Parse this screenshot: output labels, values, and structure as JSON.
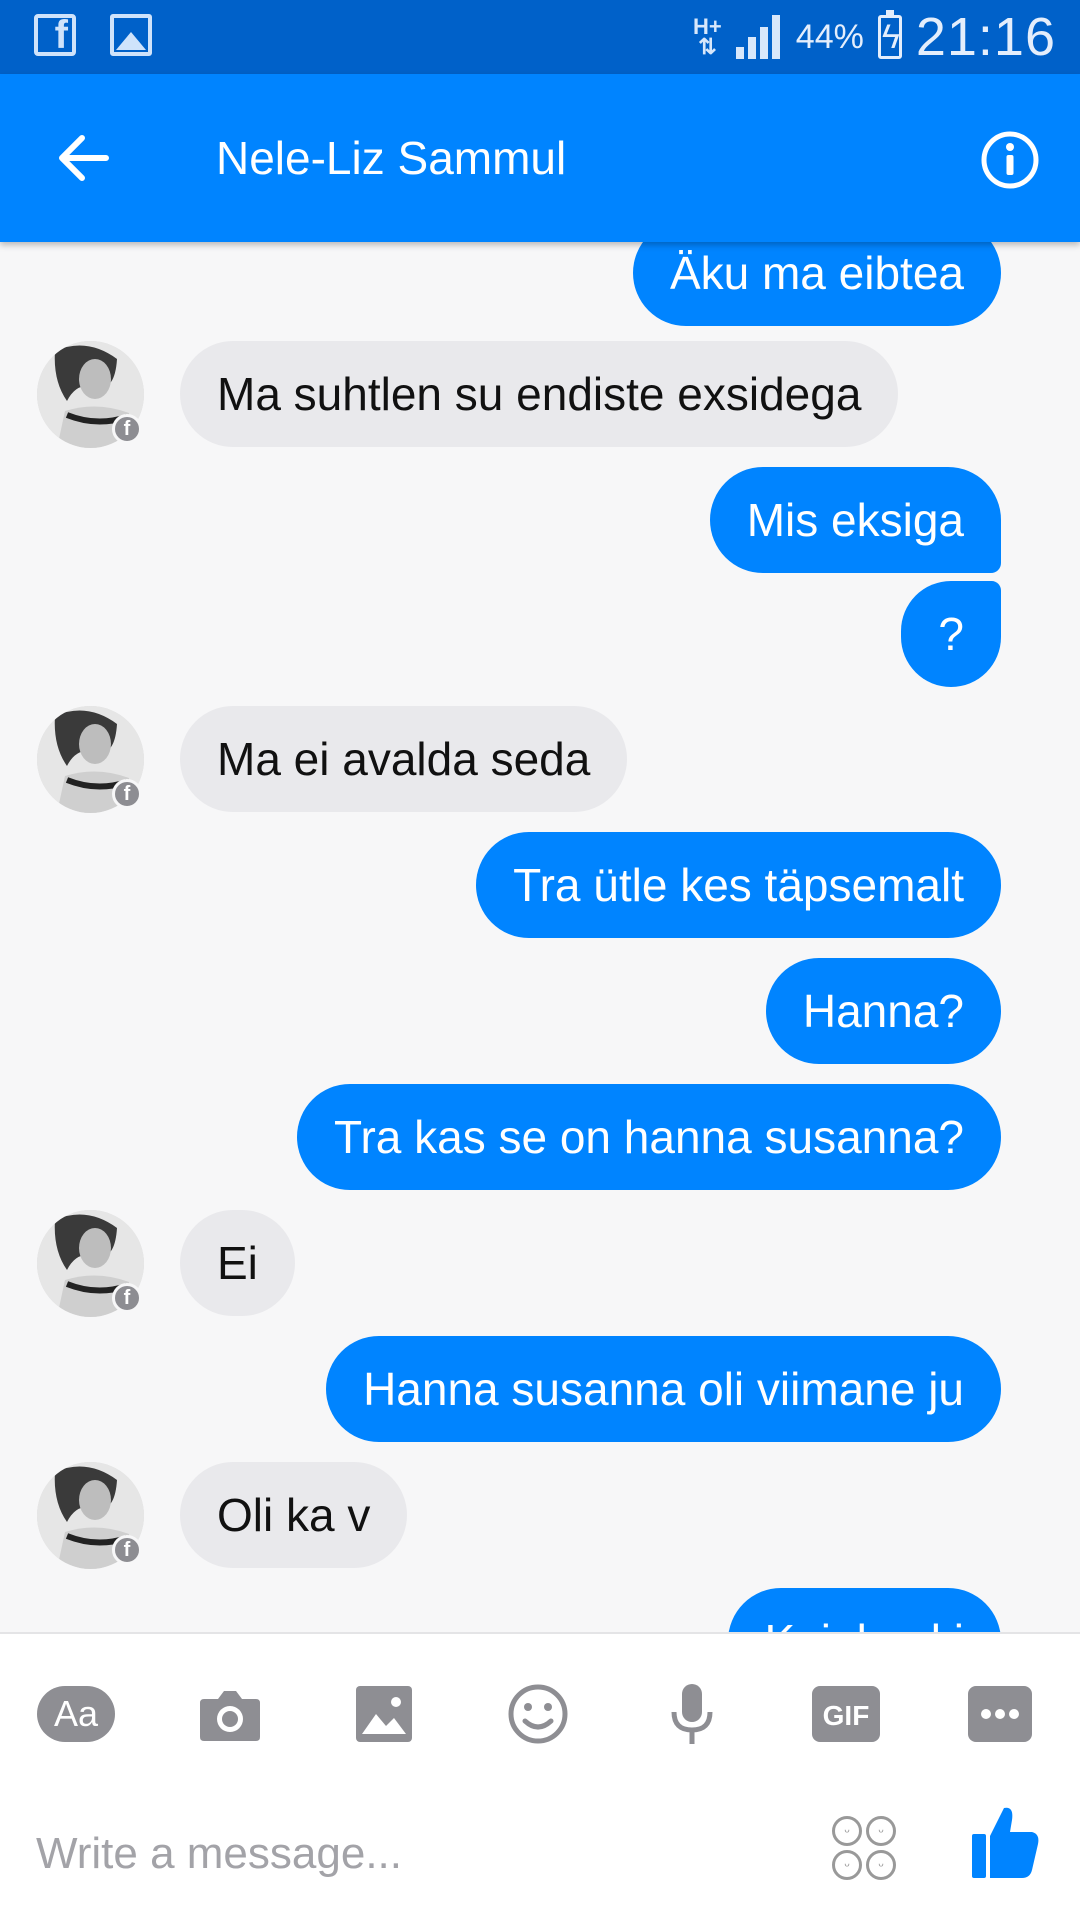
{
  "status_bar": {
    "network": "H+",
    "battery": "44%",
    "time": "21:16"
  },
  "header": {
    "title": "Nele-Liz Sammul"
  },
  "messages": [
    {
      "dir": "out",
      "text": "Äku ma eibtea"
    },
    {
      "dir": "in",
      "text": "Ma suhtlen su endiste exsidega"
    },
    {
      "dir": "out",
      "text": "Mis eksiga"
    },
    {
      "dir": "out",
      "text": "?"
    },
    {
      "dir": "in",
      "text": "Ma ei avalda seda"
    },
    {
      "dir": "out",
      "text": "Tra ütle kes täpsemalt"
    },
    {
      "dir": "out",
      "text": "Hanna?"
    },
    {
      "dir": "out",
      "text": "Tra kas se on hanna susanna?"
    },
    {
      "dir": "in",
      "text": "Ei"
    },
    {
      "dir": "out",
      "text": "Hanna susanna oli viimane ju"
    },
    {
      "dir": "in",
      "text": "Oli ka v"
    },
    {
      "dir": "out",
      "text": "Kuiekaeki"
    }
  ],
  "composer": {
    "aa_label": "Aa",
    "gif_label": "GIF",
    "placeholder": "Write a message..."
  },
  "colors": {
    "accent": "#0084ff",
    "status_bar": "#0061c9",
    "incoming_bubble": "#e9e9ec",
    "icon_gray": "#8e8e93"
  },
  "icons": [
    "facebook-icon",
    "gallery-icon",
    "signal-icon",
    "battery-icon",
    "back-arrow-icon",
    "info-icon",
    "camera-icon",
    "image-icon",
    "emoji-icon",
    "microphone-icon",
    "gif-icon",
    "more-icon",
    "stickers-icon",
    "like-icon"
  ]
}
